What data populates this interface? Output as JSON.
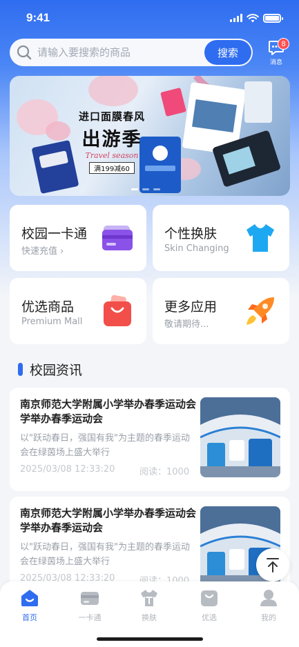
{
  "status": {
    "time": "9:41"
  },
  "search": {
    "placeholder": "请输入要搜索的商品",
    "button_label": "搜索",
    "messages_label": "消息",
    "messages_count": "8"
  },
  "banner": {
    "line1": "进口面膜春风",
    "line2": "出游季",
    "script": "Travel season",
    "promo": "满199减60"
  },
  "features": [
    {
      "title": "校园一卡通",
      "subtitle": "快速充值 ›",
      "icon": "card-icon"
    },
    {
      "title": "个性换肤",
      "subtitle": "Skin Changing",
      "icon": "tshirt-icon"
    },
    {
      "title": "优选商品",
      "subtitle": "Premium Mall",
      "icon": "shopping-bag-icon"
    },
    {
      "title": "更多应用",
      "subtitle": "敬请期待...",
      "icon": "rocket-icon"
    }
  ],
  "news": {
    "section_title": "校园资讯",
    "items": [
      {
        "title": "南京师范大学附属小学举办春季运动会学举办春季运动会",
        "summary": "以\"跃动春日，强国有我\"为主题的春季运动会在绿茵场上盛大举行",
        "date": "2025/03/08  12:33:20",
        "reads": "阅读：1000"
      },
      {
        "title": "南京师范大学附属小学举办春季运动会学举办春季运动会",
        "summary": "以\"跃动春日，强国有我\"为主题的春季运动会在绿茵场上盛大举行",
        "date": "2025/03/08  12:33:20",
        "reads": "阅读：1000"
      }
    ]
  },
  "tabbar": [
    {
      "label": "首页",
      "icon": "home-icon",
      "active": true
    },
    {
      "label": "一卡通",
      "icon": "card-icon",
      "active": false
    },
    {
      "label": "换肤",
      "icon": "tshirt-icon",
      "active": false
    },
    {
      "label": "优选",
      "icon": "shopping-bag-icon",
      "active": false
    },
    {
      "label": "我的",
      "icon": "user-icon",
      "active": false
    }
  ],
  "colors": {
    "primary": "#2f6df0",
    "badge": "#ff4d4f",
    "background": "#f3f5f9"
  }
}
